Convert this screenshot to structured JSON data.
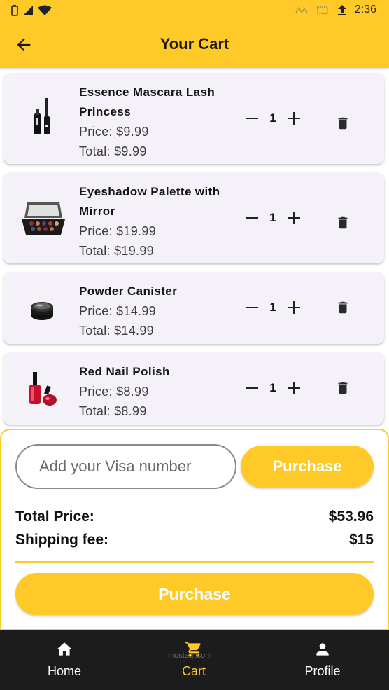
{
  "status_bar": {
    "time": "2:36"
  },
  "app_bar": {
    "title": "Your Cart"
  },
  "cart": {
    "items": [
      {
        "name": "Essence Mascara Lash Princess",
        "price": "Price: $9.99",
        "total": "Total: $9.99",
        "quantity": "1",
        "image": "mascara"
      },
      {
        "name": "Eyeshadow Palette with Mirror",
        "price": "Price: $19.99",
        "total": "Total: $19.99",
        "quantity": "1",
        "image": "eyeshadow-palette"
      },
      {
        "name": "Powder Canister",
        "price": "Price: $14.99",
        "total": "Total: $14.99",
        "quantity": "1",
        "image": "powder-canister"
      },
      {
        "name": "Red Nail Polish",
        "price": "Price: $8.99",
        "total": "Total: $8.99",
        "quantity": "1",
        "image": "nail-polish"
      }
    ]
  },
  "checkout": {
    "visa_placeholder": "Add your Visa number",
    "visa_value": "",
    "purchase_label": "Purchase",
    "total_price_label": "Total Price:",
    "total_price_value": "$53.96",
    "shipping_label": "Shipping fee:",
    "shipping_value": "$15",
    "purchase_bottom_label": "Purchase"
  },
  "bottom_nav": {
    "items": [
      {
        "label": "Home",
        "icon": "home-icon",
        "active": false
      },
      {
        "label": "Cart",
        "icon": "cart-icon",
        "active": true
      },
      {
        "label": "Profile",
        "icon": "person-icon",
        "active": false
      }
    ],
    "watermark": "mostaql.com"
  },
  "colors": {
    "accent": "#FFCA28",
    "card_bg": "#F5F1F8",
    "nav_bg": "#1c1c1c"
  }
}
